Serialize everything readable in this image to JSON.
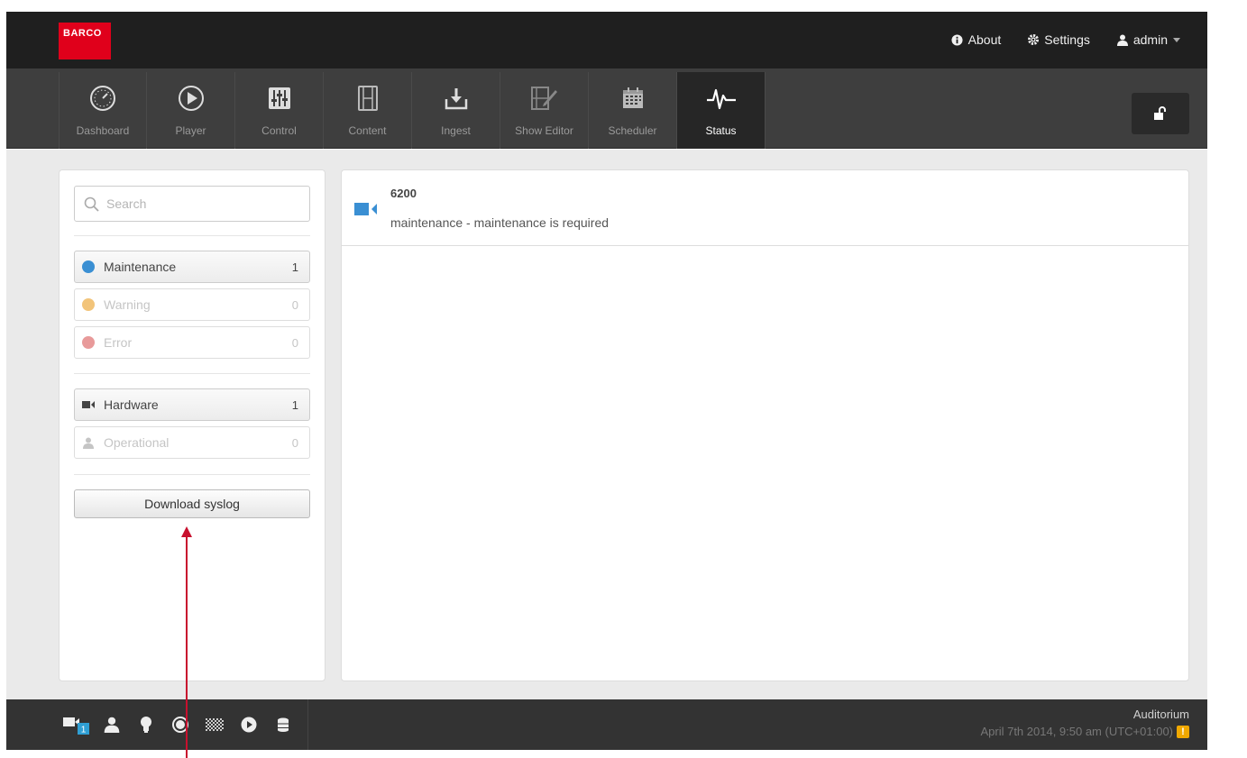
{
  "brand": {
    "logo_text": "BARCO"
  },
  "top_menu": {
    "about": "About",
    "settings": "Settings",
    "user": "admin"
  },
  "nav": {
    "items": [
      {
        "label": "Dashboard",
        "icon": "dashboard-icon"
      },
      {
        "label": "Player",
        "icon": "play-icon"
      },
      {
        "label": "Control",
        "icon": "sliders-icon"
      },
      {
        "label": "Content",
        "icon": "film-icon"
      },
      {
        "label": "Ingest",
        "icon": "download-tray-icon"
      },
      {
        "label": "Show Editor",
        "icon": "show-editor-icon"
      },
      {
        "label": "Scheduler",
        "icon": "calendar-icon"
      },
      {
        "label": "Status",
        "icon": "heartbeat-icon"
      }
    ],
    "active": "Status",
    "lock_icon": "unlock-icon"
  },
  "sidebar": {
    "search": {
      "placeholder": "Search",
      "value": ""
    },
    "severity_filters": [
      {
        "label": "Maintenance",
        "count": "1",
        "color": "#3a8fd3",
        "enabled": true
      },
      {
        "label": "Warning",
        "count": "0",
        "color": "#f2c47a",
        "enabled": false
      },
      {
        "label": "Error",
        "count": "0",
        "color": "#e89a9a",
        "enabled": false
      }
    ],
    "category_filters": [
      {
        "label": "Hardware",
        "count": "1",
        "icon": "camera-icon",
        "enabled": true
      },
      {
        "label": "Operational",
        "count": "0",
        "icon": "user-icon",
        "enabled": false
      }
    ],
    "download_button": "Download syslog"
  },
  "status_list": [
    {
      "title": "6200",
      "message": "maintenance - maintenance is required",
      "icon": "camera-icon",
      "color": "#3a8fd3"
    }
  ],
  "bottom_bar": {
    "icons": [
      "projector-icon",
      "user-icon",
      "lamp-icon",
      "record-icon",
      "checkerboard-icon",
      "play-circle-icon",
      "database-icon"
    ],
    "badge": "1",
    "venue": "Auditorium",
    "datetime": "April 7th 2014, 9:50 am (UTC+01:00)",
    "alert_icon": "warning-icon"
  },
  "colors": {
    "accent": "#e0001b",
    "maintenance": "#3a8fd3",
    "topbar": "#1f1f1f",
    "navbar": "#3e3e3e",
    "arrow": "#c8102e"
  }
}
